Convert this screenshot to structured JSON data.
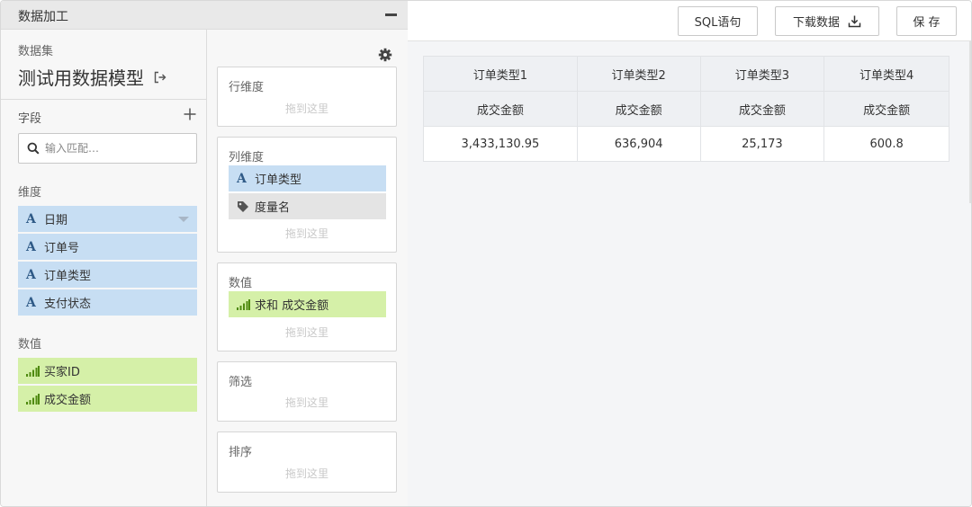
{
  "panel": {
    "title": "数据加工"
  },
  "dataset": {
    "label": "数据集",
    "name": "测试用数据模型"
  },
  "fields": {
    "label": "字段",
    "search_placeholder": "输入匹配…",
    "dimension_label": "维度",
    "dimensions": [
      "日期",
      "订单号",
      "订单类型",
      "支付状态"
    ],
    "measure_label": "数值",
    "measures": [
      "买家ID",
      "成交金额"
    ]
  },
  "config": {
    "drop_hint": "拖到这里",
    "row_dim": {
      "title": "行维度"
    },
    "col_dim": {
      "title": "列维度",
      "items": [
        "订单类型",
        "度量名"
      ]
    },
    "values": {
      "title": "数值",
      "items": [
        "求和 成交金额"
      ]
    },
    "filter": {
      "title": "筛选"
    },
    "sort": {
      "title": "排序"
    }
  },
  "toolbar": {
    "sql": "SQL语句",
    "download": "下载数据",
    "save": "保 存"
  },
  "table": {
    "headers": [
      "订单类型1",
      "订单类型2",
      "订单类型3",
      "订单类型4"
    ],
    "sub_headers": [
      "成交金额",
      "成交金额",
      "成交金额",
      "成交金额"
    ],
    "values": [
      "3,433,130.95",
      "636,904",
      "25,173",
      "600.8"
    ]
  },
  "colors": {
    "dimension": "#c7def3",
    "measure": "#d5f0a8",
    "tag": "#e4e4e4",
    "dim_icon": "#2f5a87",
    "measure_icon": "#4f8a10"
  },
  "icons": {
    "exit": "exit-icon",
    "add": "plus-icon",
    "search": "search-icon",
    "settings": "gear-icon",
    "download": "download-icon",
    "tag": "tag-icon",
    "collapse": "minus-icon"
  }
}
